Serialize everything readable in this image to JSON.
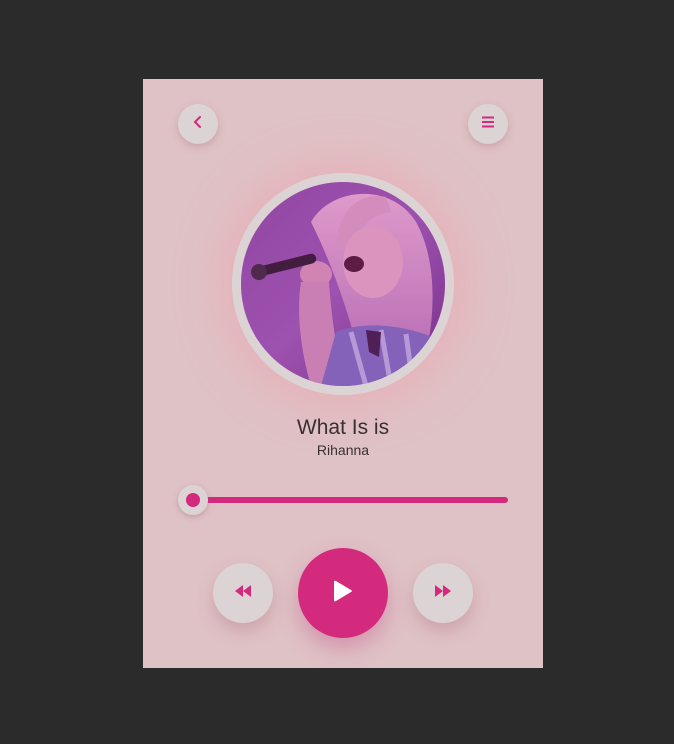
{
  "player": {
    "nav": {
      "back_icon": "chevron-left-icon",
      "menu_icon": "hamburger-menu-icon"
    },
    "track": {
      "title": "What Is is",
      "artist": "Rihanna"
    },
    "progress": {
      "fraction": 0.0
    },
    "controls": {
      "rewind_icon": "rewind-icon",
      "play_icon": "play-icon",
      "forward_icon": "fast-forward-icon"
    },
    "colors": {
      "accent": "#d42a7e",
      "card_background": "#dfc2c6",
      "button_background": "#dcd3d5",
      "page_background": "#2b2b2b"
    }
  }
}
